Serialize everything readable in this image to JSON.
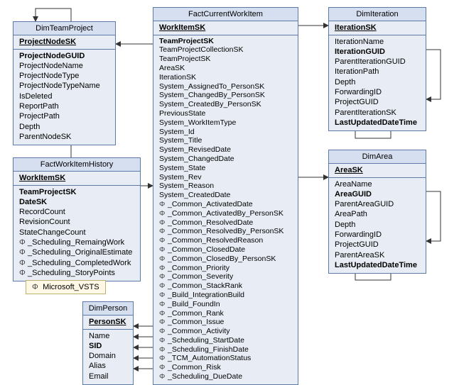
{
  "legend": {
    "label": "Microsoft_VSTS",
    "symbol": "Φ"
  },
  "entities": {
    "dimTeamProject": {
      "title": "DimTeamProject",
      "pk": "ProjectNodeSK",
      "fields": [
        {
          "name": "ProjectNodeGUID",
          "bold": true
        },
        {
          "name": "ProjectNodeName"
        },
        {
          "name": "ProjectNodeType"
        },
        {
          "name": "ProjectNodeTypeName"
        },
        {
          "name": "IsDeleted"
        },
        {
          "name": "ReportPath"
        },
        {
          "name": "ProjectPath"
        },
        {
          "name": "Depth"
        },
        {
          "name": "ParentNodeSK"
        }
      ]
    },
    "factWorkItemHistory": {
      "title": "FactWorkItemHistory",
      "pk": "WorkItemSK",
      "fields": [
        {
          "name": "TeamProjectSK",
          "bold": true
        },
        {
          "name": "DateSK",
          "bold": true
        },
        {
          "name": "RecordCount"
        },
        {
          "name": "RevisionCount"
        },
        {
          "name": "StateChangeCount"
        },
        {
          "name": "_Scheduling_RemaingWork",
          "phi": true
        },
        {
          "name": "_Scheduling_OriginalEstimate",
          "phi": true
        },
        {
          "name": "_Scheduling_CompletedWork",
          "phi": true
        },
        {
          "name": "_Scheduling_StoryPoints",
          "phi": true
        }
      ]
    },
    "dimPerson": {
      "title": "DimPerson",
      "pk": "PersonSK",
      "fields": [
        {
          "name": "Name"
        },
        {
          "name": "SID",
          "bold": true
        },
        {
          "name": "Domain"
        },
        {
          "name": "Alias"
        },
        {
          "name": "Email"
        }
      ]
    },
    "factCurrentWorkItem": {
      "title": "FactCurrentWorkItem",
      "pk": "WorkItemSK",
      "fields": [
        {
          "name": "TeamProjectSK",
          "bold": true
        },
        {
          "name": "TeamProjectCollectionSK"
        },
        {
          "name": "TeamProjectSK"
        },
        {
          "name": "AreaSK"
        },
        {
          "name": "IterationSK"
        },
        {
          "name": "System_AssignedTo_PersonSK"
        },
        {
          "name": "System_ChangedBy_PersonSK"
        },
        {
          "name": "System_CreatedBy_PersonSK"
        },
        {
          "name": "PreviousState"
        },
        {
          "name": "System_WorkItemType"
        },
        {
          "name": "System_Id"
        },
        {
          "name": "System_Title"
        },
        {
          "name": "System_RevisedDate"
        },
        {
          "name": "System_ChangedDate"
        },
        {
          "name": "System_State"
        },
        {
          "name": "System_Rev"
        },
        {
          "name": "System_Reason"
        },
        {
          "name": "System_CreatedDate"
        },
        {
          "name": "_Common_ActivatedDate",
          "phi": true
        },
        {
          "name": "_Common_ActivatedBy_PersonSK",
          "phi": true
        },
        {
          "name": "_Common_ResolvedDate",
          "phi": true
        },
        {
          "name": "_Common_ResolvedBy_PersonSK",
          "phi": true
        },
        {
          "name": "_Common_ResolvedReason",
          "phi": true
        },
        {
          "name": "_Common_ClosedDate",
          "phi": true
        },
        {
          "name": "_Common_ClosedBy_PersonSK",
          "phi": true
        },
        {
          "name": "_Common_Priority",
          "phi": true
        },
        {
          "name": "_Common_Severity",
          "phi": true
        },
        {
          "name": "_Common_StackRank",
          "phi": true
        },
        {
          "name": "_Build_IntegrationBuild",
          "phi": true
        },
        {
          "name": "_Build_FoundIn",
          "phi": true
        },
        {
          "name": "_Common_Rank",
          "phi": true
        },
        {
          "name": "_Common_Issue",
          "phi": true
        },
        {
          "name": "_Common_Activity",
          "phi": true
        },
        {
          "name": "_Scheduling_StartDate",
          "phi": true
        },
        {
          "name": "_Scheduling_FinishDate",
          "phi": true
        },
        {
          "name": "_TCM_AutomationStatus",
          "phi": true
        },
        {
          "name": "_Common_Risk",
          "phi": true
        },
        {
          "name": "_Scheduling_DueDate",
          "phi": true
        }
      ]
    },
    "dimIteration": {
      "title": "DimIteration",
      "pk": "IterationSK",
      "fields": [
        {
          "name": "IterationName"
        },
        {
          "name": "IterationGUID",
          "bold": true
        },
        {
          "name": "ParentIterationGUID"
        },
        {
          "name": "IterationPath"
        },
        {
          "name": "Depth"
        },
        {
          "name": "ForwardingID"
        },
        {
          "name": "ProjectGUID"
        },
        {
          "name": "ParentIterationSK"
        },
        {
          "name": "LastUpdatedDateTime",
          "bold": true
        }
      ]
    },
    "dimArea": {
      "title": "DimArea",
      "pk": "AreaSK",
      "fields": [
        {
          "name": "AreaName"
        },
        {
          "name": "AreaGUID",
          "bold": true
        },
        {
          "name": "ParentAreaGUID"
        },
        {
          "name": "AreaPath"
        },
        {
          "name": "Depth"
        },
        {
          "name": "ForwardingID"
        },
        {
          "name": "ProjectGUID"
        },
        {
          "name": "ParentAreaSK"
        },
        {
          "name": "LastUpdatedDateTime",
          "bold": true
        }
      ]
    }
  }
}
